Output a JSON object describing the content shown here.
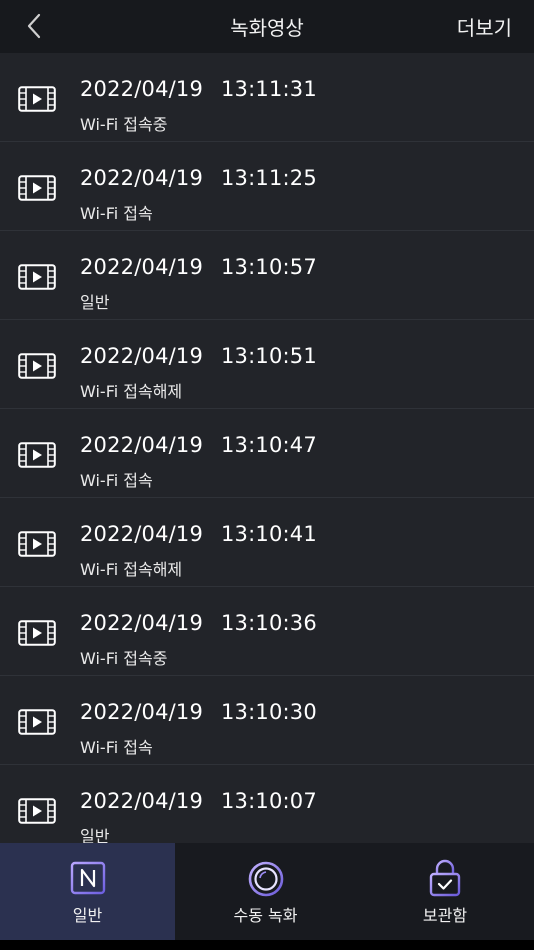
{
  "header": {
    "title": "녹화영상",
    "more_label": "더보기"
  },
  "recordings": [
    {
      "date": "2022/04/19",
      "time": "13:11:31",
      "status": "Wi-Fi 접속중"
    },
    {
      "date": "2022/04/19",
      "time": "13:11:25",
      "status": "Wi-Fi 접속"
    },
    {
      "date": "2022/04/19",
      "time": "13:10:57",
      "status": "일반"
    },
    {
      "date": "2022/04/19",
      "time": "13:10:51",
      "status": "Wi-Fi 접속해제"
    },
    {
      "date": "2022/04/19",
      "time": "13:10:47",
      "status": "Wi-Fi 접속"
    },
    {
      "date": "2022/04/19",
      "time": "13:10:41",
      "status": "Wi-Fi 접속해제"
    },
    {
      "date": "2022/04/19",
      "time": "13:10:36",
      "status": "Wi-Fi 접속중"
    },
    {
      "date": "2022/04/19",
      "time": "13:10:30",
      "status": "Wi-Fi 접속"
    },
    {
      "date": "2022/04/19",
      "time": "13:10:07",
      "status": "일반"
    }
  ],
  "tabs": [
    {
      "label": "일반",
      "icon": "normal-n-icon",
      "active": true
    },
    {
      "label": "수동 녹화",
      "icon": "manual-record-icon",
      "active": false
    },
    {
      "label": "보관함",
      "icon": "lock-storage-icon",
      "active": false
    }
  ],
  "colors": {
    "background": "#222429",
    "header": "#17191d",
    "active_tab": "#2b3150",
    "accent_purple": "#8f7cf0"
  }
}
